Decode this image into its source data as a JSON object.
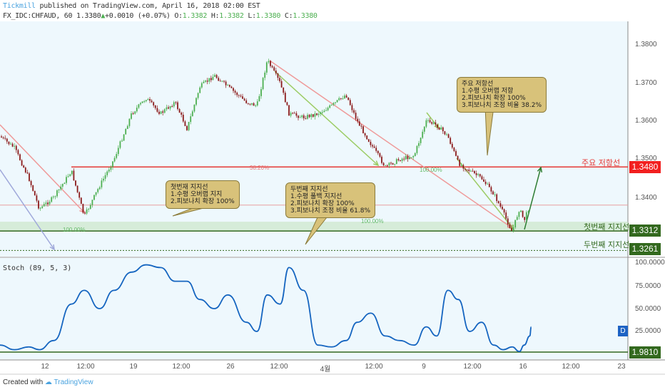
{
  "header": {
    "author": "Tickmill",
    "published": "published on TradingView.com, April 16, 2018 02:00 EST",
    "symbol": "FX_IDC:CHFAUD, 60",
    "last": "1.3380",
    "change": "+0.0010 (+0.07%)",
    "o_label": "O:",
    "o": "1.3382",
    "h_label": "H:",
    "h": "1.3382",
    "l_label": "L:",
    "l": "1.3380",
    "c_label": "C:",
    "c": "1.3380"
  },
  "footer": {
    "created_with": "Created with",
    "brand": "TradingView"
  },
  "colors": {
    "background": "#eef8fd",
    "up": "#4caf50",
    "down": "#8b1a1a",
    "resistance": "#e53935",
    "support": "#33691e",
    "stoch": "#1565c0",
    "callout": "#d8c27a"
  },
  "annotations": {
    "resistance_callout": "주요 저항선\n1.수평 오버랩 저항\n2.피보나치 확장 100%\n3.피보나치 조정 비율 38.2%",
    "first_support_callout": "첫번재 지지선\n1.수평 오버랩 지지\n2.피보나치 확장 100%",
    "second_support_callout": "두번째 지지선\n1.수평 풀백 지지선\n2.피보나치 확장 100%\n3.피보나치 조정 비율 61.8%",
    "resistance_label": "주요 저항선",
    "first_support_label": "첫번째 지지선",
    "second_support_label": "두번째 지지선",
    "fib_382": "38.20%",
    "fib_100_a": "100.00%",
    "fib_100_b": "100.00%",
    "fib_100_c": "100.00%"
  },
  "chart_data": [
    {
      "type": "candlestick",
      "title": "FX_IDC:CHFAUD, 60",
      "ylim": [
        1.3235,
        1.385
      ],
      "yticks": [
        "1.3800",
        "1.3700",
        "1.3600",
        "1.3500",
        "1.3400"
      ],
      "xticks": [
        "12",
        "12:00",
        "19",
        "12:00",
        "26",
        "12:00",
        "4월",
        "12:00",
        "9",
        "12:00",
        "16",
        "12:00",
        "23"
      ],
      "levels": {
        "resistance": "1.3480",
        "first_support": "1.3312",
        "second_support": "1.3261"
      },
      "close": [
        [
          "2018-03-07 16:00",
          1.356
        ],
        [
          "2018-03-08 10:00",
          1.353
        ],
        [
          "2018-03-09 04:00",
          1.345
        ],
        [
          "2018-03-09 17:00",
          1.337
        ],
        [
          "2018-03-12 11:00",
          1.34
        ],
        [
          "2018-03-13 09:00",
          1.347
        ],
        [
          "2018-03-14 01:00",
          1.335
        ],
        [
          "2018-03-14 20:00",
          1.343
        ],
        [
          "2018-03-15 14:00",
          1.35
        ],
        [
          "2018-03-16 12:00",
          1.362
        ],
        [
          "2018-03-19 06:00",
          1.366
        ],
        [
          "2018-03-20 00:00",
          1.362
        ],
        [
          "2018-03-20 18:00",
          1.365
        ],
        [
          "2018-03-21 09:00",
          1.358
        ],
        [
          "2018-03-22 01:00",
          1.369
        ],
        [
          "2018-03-22 19:00",
          1.372
        ],
        [
          "2018-03-23 12:00",
          1.369
        ],
        [
          "2018-03-26 11:00",
          1.365
        ],
        [
          "2018-03-27 00:00",
          1.364
        ],
        [
          "2018-03-27 13:00",
          1.376
        ],
        [
          "2018-03-28 05:00",
          1.37
        ],
        [
          "2018-03-28 16:00",
          1.362
        ],
        [
          "2018-03-29 10:00",
          1.361
        ],
        [
          "2018-03-30 04:00",
          1.362
        ],
        [
          "2018-03-30 21:00",
          1.364
        ],
        [
          "2018-04-02 15:00",
          1.367
        ],
        [
          "2018-04-03 05:00",
          1.36
        ],
        [
          "2018-04-03 22:00",
          1.354
        ],
        [
          "2018-04-04 16:00",
          1.348
        ],
        [
          "2018-04-05 10:00",
          1.35
        ],
        [
          "2018-04-06 04:00",
          1.351
        ],
        [
          "2018-04-06 19:00",
          1.36
        ],
        [
          "2018-04-09 08:00",
          1.359
        ],
        [
          "2018-04-09 22:00",
          1.356
        ],
        [
          "2018-04-10 11:00",
          1.349
        ],
        [
          "2018-04-11 01:00",
          1.347
        ],
        [
          "2018-04-11 16:00",
          1.345
        ],
        [
          "2018-04-12 07:00",
          1.341
        ],
        [
          "2018-04-12 19:00",
          1.336
        ],
        [
          "2018-04-13 06:00",
          1.331
        ],
        [
          "2018-04-13 15:00",
          1.337
        ],
        [
          "2018-04-13 21:00",
          1.334
        ],
        [
          "2018-04-16 04:00",
          1.338
        ]
      ]
    },
    {
      "type": "line",
      "title": "Stoch (89, 5, 3)",
      "ylim": [
        0,
        100
      ],
      "yticks": [
        "100.0000",
        "75.0000",
        "50.0000",
        "25.0000"
      ],
      "last_label": "1.9810",
      "badge": "D",
      "values": [
        10,
        5,
        8,
        5,
        15,
        55,
        70,
        50,
        70,
        90,
        98,
        95,
        80,
        80,
        60,
        50,
        65,
        35,
        25,
        65,
        55,
        95,
        70,
        10,
        8,
        15,
        35,
        45,
        20,
        15,
        10,
        30,
        20,
        70,
        60,
        25,
        35,
        10,
        5,
        8,
        3,
        10,
        20,
        30,
        25
      ]
    }
  ]
}
